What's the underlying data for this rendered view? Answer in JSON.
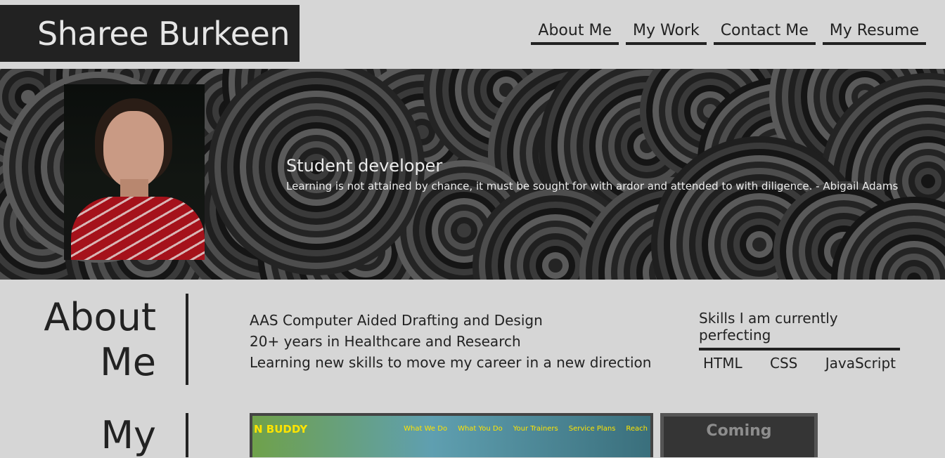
{
  "site": {
    "name": "Sharee Burkeen"
  },
  "nav": [
    {
      "label": "About Me"
    },
    {
      "label": "My Work"
    },
    {
      "label": "Contact Me"
    },
    {
      "label": "My Resume"
    }
  ],
  "hero": {
    "title": "Student developer",
    "quote": "Learning is not attained by chance, it must be sought for with ardor and attended to with diligence. - Abigail Adams"
  },
  "about": {
    "heading_line1": "About",
    "heading_line2": "Me",
    "items": [
      "AAS Computer Aided Drafting and Design",
      "20+ years in Healthcare and Research",
      "Learning new skills to move my career in a new direction"
    ],
    "skills_heading": "Skills I am currently perfecting",
    "skills": [
      "HTML",
      "CSS",
      "JavaScript"
    ]
  },
  "work": {
    "heading_line1": "My",
    "project1": {
      "brand": "N BUDDY",
      "nav": [
        "What We Do",
        "What You Do",
        "Your Trainers",
        "Service Plans",
        "Reach"
      ]
    },
    "project2": {
      "label": "Coming"
    }
  },
  "colors": {
    "dark": "#222222",
    "page_bg": "#d6d6d6",
    "accent_yellow": "#ffe400"
  }
}
